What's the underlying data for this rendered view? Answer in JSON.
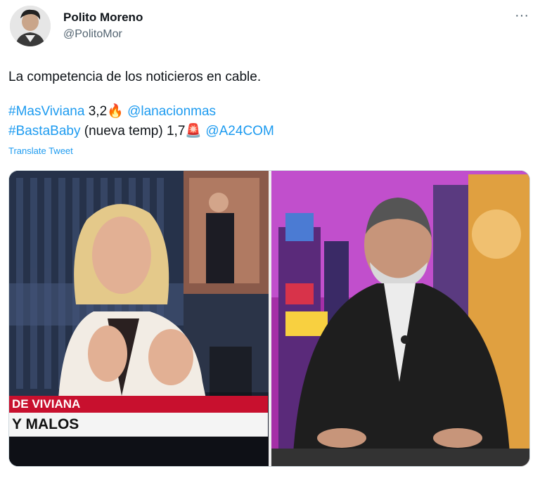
{
  "author": {
    "display_name": "Polito Moreno",
    "handle": "@PolitoMor"
  },
  "menu_icon": "more-horizontal-icon",
  "tweet": {
    "text_line": "La competencia de los noticieros en cable.",
    "line1": {
      "hashtag": "#MasViviana",
      "value": "3,2",
      "emoji": "🔥",
      "mention": "@lanacionmas"
    },
    "line2": {
      "hashtag": "#BastaBaby",
      "suffix": "(nueva temp) 1,7",
      "emoji": "🚨",
      "mention": "@A24COM"
    },
    "translate_label": "Translate Tweet"
  },
  "media": {
    "left_ticker_red": "DE VIVIANA",
    "left_ticker_white": "Y MALOS"
  },
  "colors": {
    "link": "#1d9bf0",
    "secondary_text": "#536471",
    "ticker_red": "#c8102e"
  }
}
